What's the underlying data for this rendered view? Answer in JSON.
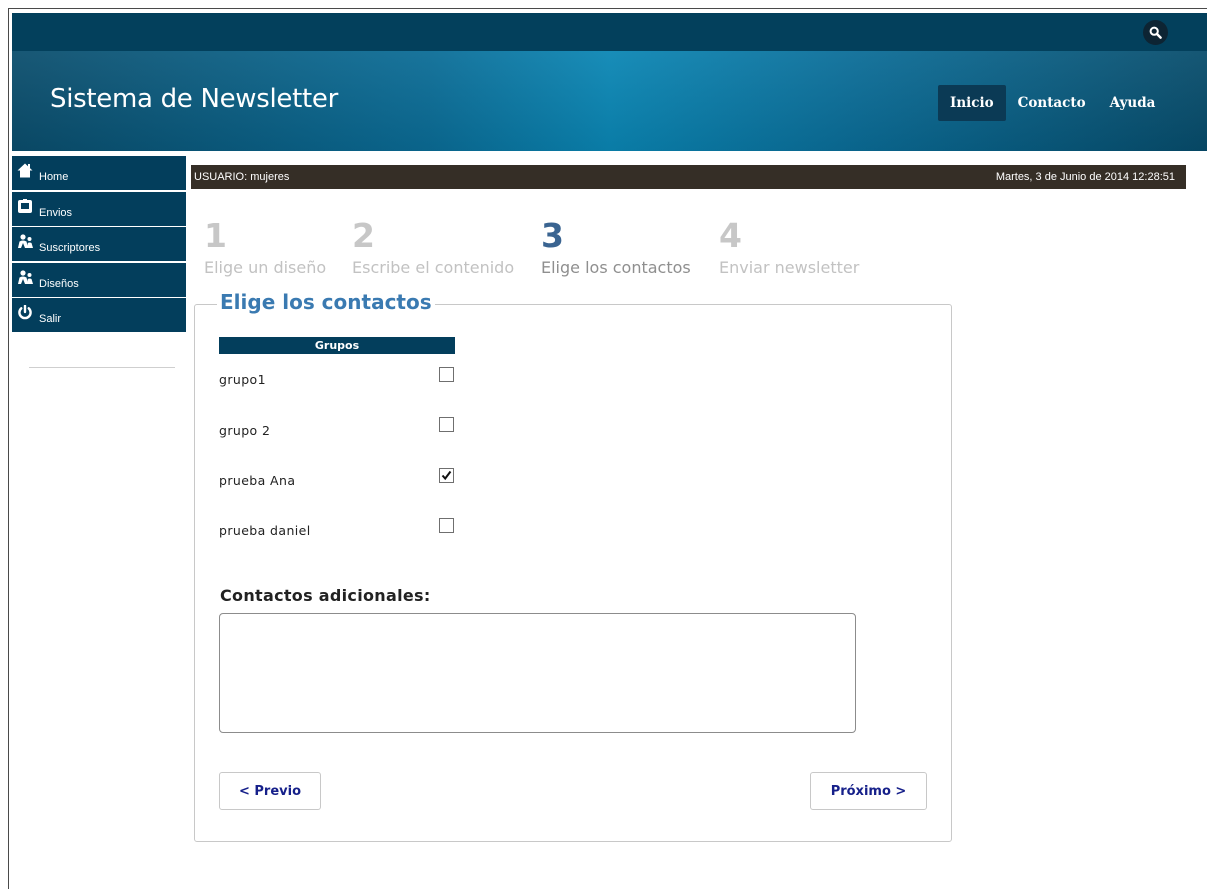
{
  "header": {
    "site_title": "Sistema de Newsletter",
    "nav": [
      "Inicio",
      "Contacto",
      "Ayuda"
    ],
    "active_nav": "Inicio",
    "search_icon": "search-icon"
  },
  "sidebar": {
    "items": [
      {
        "label": "Home",
        "icon": "home-icon"
      },
      {
        "label": "Envios",
        "icon": "envelope-icon"
      },
      {
        "label": "Suscriptores",
        "icon": "users-icon"
      },
      {
        "label": "Diseños",
        "icon": "users-icon"
      },
      {
        "label": "Salir",
        "icon": "power-icon"
      }
    ]
  },
  "userbar": {
    "user": "USUARIO: mujeres",
    "datetime": "Martes, 3 de Junio de 2014 12:28:51"
  },
  "steps": [
    {
      "num": "1",
      "label": "Elige un diseño",
      "active": false
    },
    {
      "num": "2",
      "label": "Escribe el contenido",
      "active": false
    },
    {
      "num": "3",
      "label": "Elige los contactos",
      "active": true
    },
    {
      "num": "4",
      "label": "Enviar newsletter",
      "active": false
    }
  ],
  "form": {
    "legend": "Elige los contactos",
    "groups_header": "Grupos",
    "groups": [
      {
        "name": "grupo1",
        "checked": false
      },
      {
        "name": "grupo 2",
        "checked": false
      },
      {
        "name": "prueba Ana",
        "checked": true
      },
      {
        "name": "prueba daniel",
        "checked": false
      }
    ],
    "additional_label": "Contactos adicionales:",
    "additional_value": "",
    "prev_label": "< Previo",
    "next_label": "Próximo >"
  },
  "colors": {
    "navy": "#033e5c",
    "step_active": "#3a6491",
    "legend": "#3a7ab1",
    "button_text": "#16208a"
  }
}
